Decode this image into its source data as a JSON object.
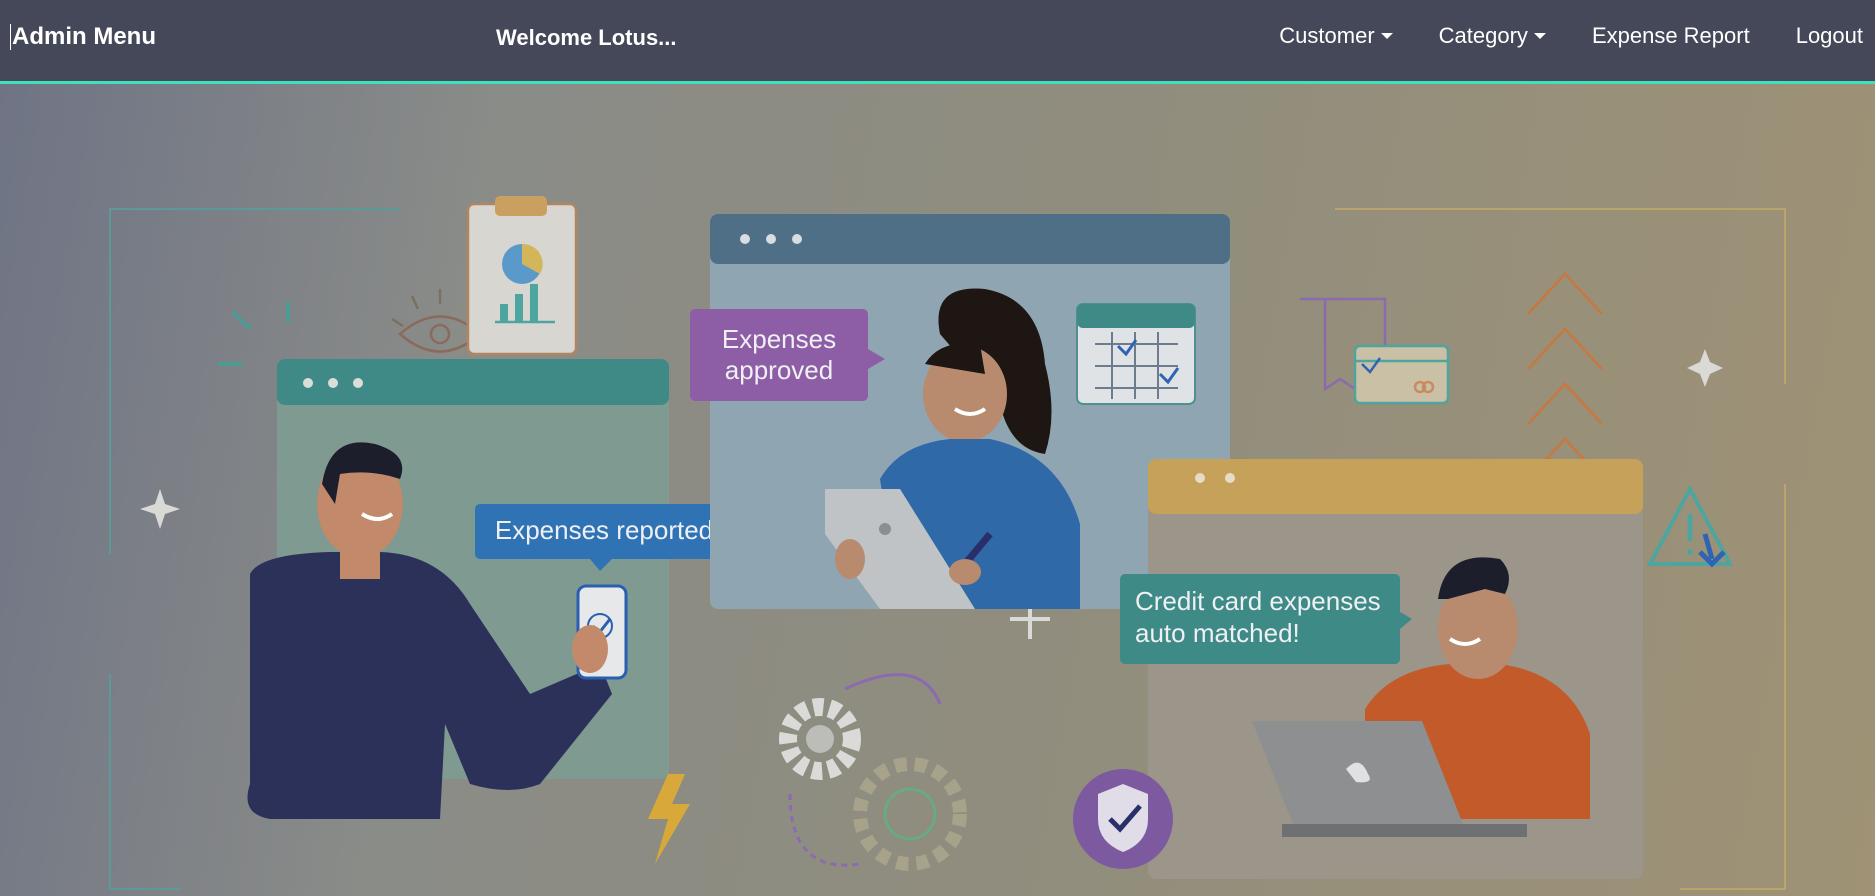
{
  "navbar": {
    "brand": "Admin Menu",
    "welcome": "Welcome Lotus...",
    "links": [
      {
        "label": "Customer",
        "dropdown": true
      },
      {
        "label": "Category",
        "dropdown": true
      },
      {
        "label": "Expense Report",
        "dropdown": false
      },
      {
        "label": "Logout",
        "dropdown": false
      }
    ],
    "accent_color": "#3fe0bb",
    "bg_color": "#454858"
  },
  "hero": {
    "bubbles": {
      "approved_line1": "Expenses",
      "approved_line2": "approved",
      "reported": "Expenses reported",
      "credit_line1": "Credit card expenses",
      "credit_line2": "auto matched!"
    }
  }
}
